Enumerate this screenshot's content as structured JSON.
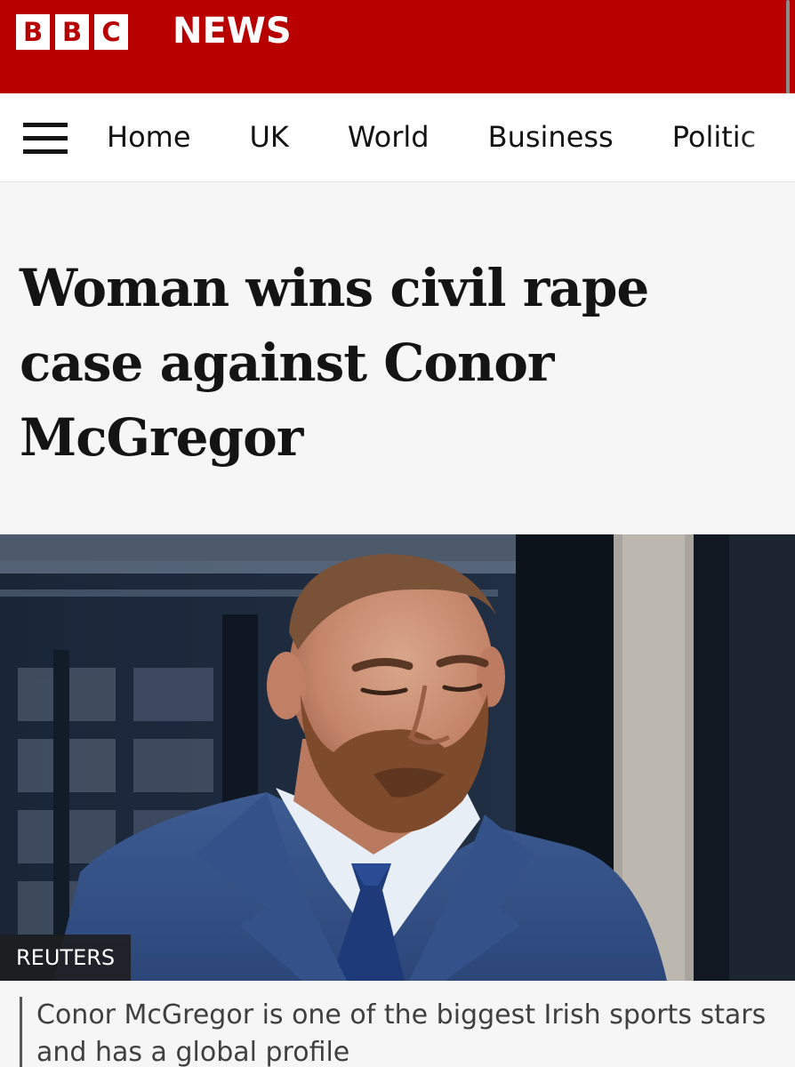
{
  "header": {
    "logo_letters": [
      "B",
      "B",
      "C"
    ],
    "brand_word": "NEWS",
    "brand_color": "#b80000"
  },
  "nav": {
    "menu_icon": "hamburger-menu-icon",
    "items": [
      {
        "label": "Home"
      },
      {
        "label": "UK"
      },
      {
        "label": "World"
      },
      {
        "label": "Business"
      },
      {
        "label": "Politic"
      }
    ]
  },
  "article": {
    "headline": "Woman wins civil rape case against Conor McGregor",
    "image": {
      "credit": "REUTERS"
    },
    "caption": "Conor McGregor is one of the biggest Irish sports stars and has a global profile"
  }
}
